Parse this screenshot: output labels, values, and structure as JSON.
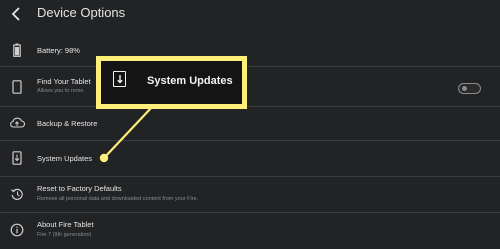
{
  "header": {
    "title": "Device Options",
    "back_icon": "chevron-left-icon"
  },
  "settings": {
    "battery": {
      "label": "Battery: 98%",
      "icon": "battery-icon"
    },
    "find_tablet": {
      "label": "Find Your Tablet",
      "sublabel": "Allows you to remo",
      "icon": "tablet-icon",
      "toggle_on": false
    },
    "backup": {
      "label": "Backup & Restore",
      "icon": "cloud-sync-icon"
    },
    "system_updates": {
      "label": "System Updates",
      "icon": "system-update-icon"
    },
    "factory_reset": {
      "label": "Reset to Factory Defaults",
      "sublabel": "Remove all personal data and downloaded content from your Fire.",
      "icon": "restore-icon"
    },
    "about": {
      "label": "About Fire Tablet",
      "sublabel": "Fire 7 (9th generation)",
      "icon": "info-icon"
    }
  },
  "callout": {
    "text": "System Updates",
    "icon": "system-update-icon",
    "color": "#fdef79"
  },
  "colors": {
    "background": "#222325",
    "divider": "#3a3b3d",
    "highlight": "#fdef79"
  }
}
